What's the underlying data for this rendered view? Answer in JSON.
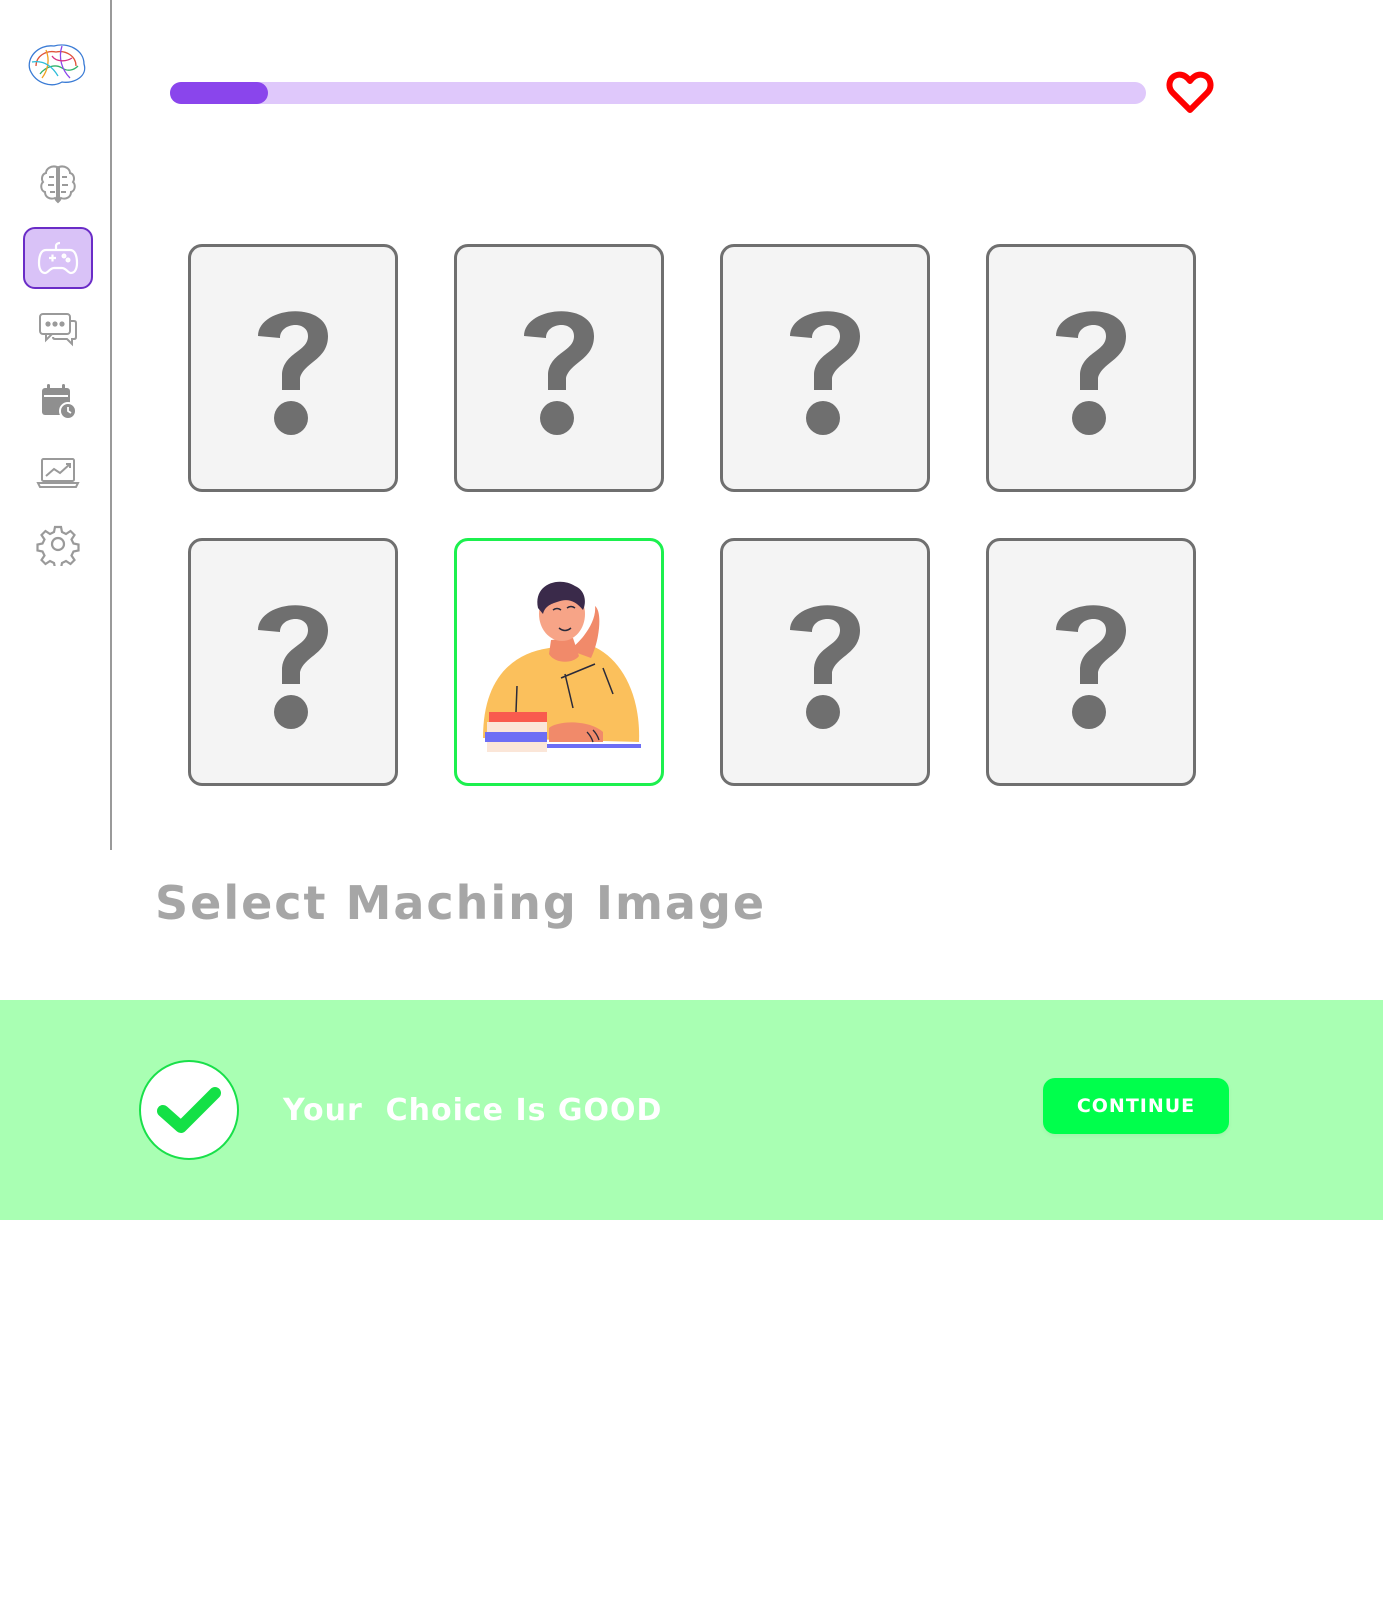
{
  "sidebar": {
    "items": [
      {
        "icon": "brain-icon",
        "active": false
      },
      {
        "icon": "gamepad-icon",
        "active": true
      },
      {
        "icon": "chat-icon",
        "active": false
      },
      {
        "icon": "calendar-clock-icon",
        "active": false
      },
      {
        "icon": "laptop-chart-icon",
        "active": false
      },
      {
        "icon": "gear-icon",
        "active": false
      }
    ]
  },
  "progress": {
    "value_fraction": 0.1
  },
  "lives": {
    "icon": "heart-icon",
    "color": "#ff0000"
  },
  "cards": [
    {
      "state": "hidden",
      "icon": "question-mark-icon"
    },
    {
      "state": "hidden",
      "icon": "question-mark-icon"
    },
    {
      "state": "hidden",
      "icon": "question-mark-icon"
    },
    {
      "state": "hidden",
      "icon": "question-mark-icon"
    },
    {
      "state": "hidden",
      "icon": "question-mark-icon"
    },
    {
      "state": "revealed",
      "icon": "thinking-student-illustration"
    },
    {
      "state": "hidden",
      "icon": "question-mark-icon"
    },
    {
      "state": "hidden",
      "icon": "question-mark-icon"
    }
  ],
  "instruction": "Select Maching Image",
  "feedback": {
    "message": "Your  Choice Is GOOD",
    "icon": "checkmark-icon",
    "continue_label": "CONTINUE",
    "colors": {
      "banner": "#a9ffb3",
      "accent": "#00ff4c"
    }
  },
  "colors": {
    "accent": "#8a45ec",
    "progress_track": "#dfc8fb"
  }
}
